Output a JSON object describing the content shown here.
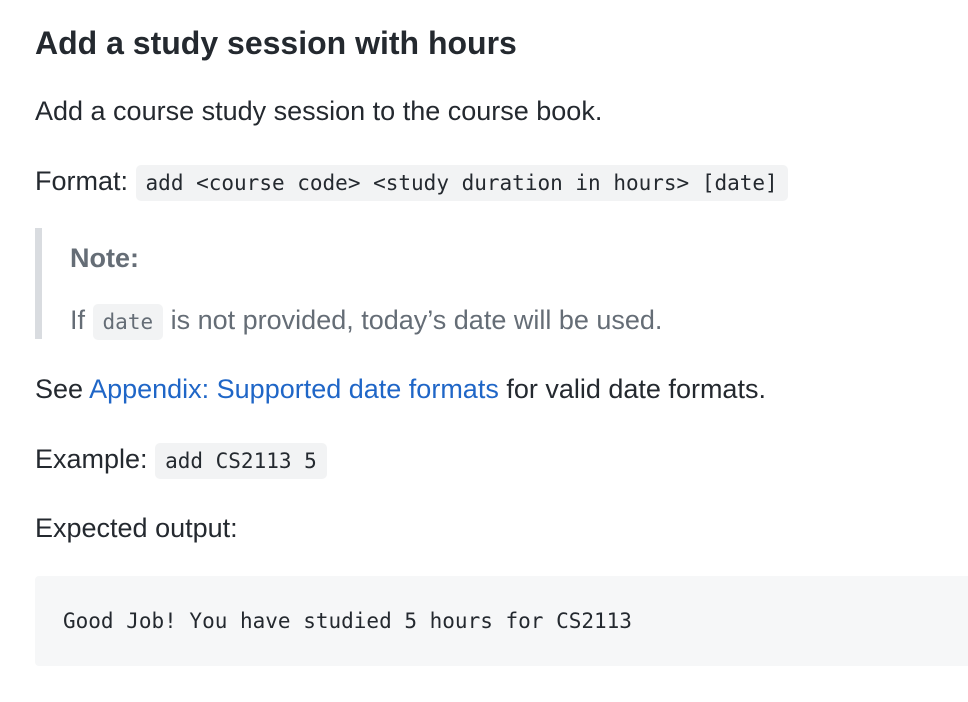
{
  "heading": "Add a study session with hours",
  "description": "Add a course study session to the course book.",
  "format": {
    "label": "Format:",
    "code": "add <course code> <study duration in hours> [date]"
  },
  "note": {
    "title": "Note:",
    "prefix": "If",
    "code": "date",
    "suffix": "is not provided, today’s date will be used."
  },
  "see": {
    "prefix": "See",
    "link_text": "Appendix: Supported date formats",
    "suffix": "for valid date formats."
  },
  "example": {
    "label": "Example:",
    "code": "add CS2113 5"
  },
  "expected": {
    "label": "Expected output:",
    "output": "Good Job! You have studied 5 hours for CS2113"
  },
  "colors": {
    "link": "#1f66c7",
    "text": "#24292f",
    "muted": "#656d76",
    "code_bg": "#f2f3f4",
    "blockquote_border": "#d9dce0"
  }
}
